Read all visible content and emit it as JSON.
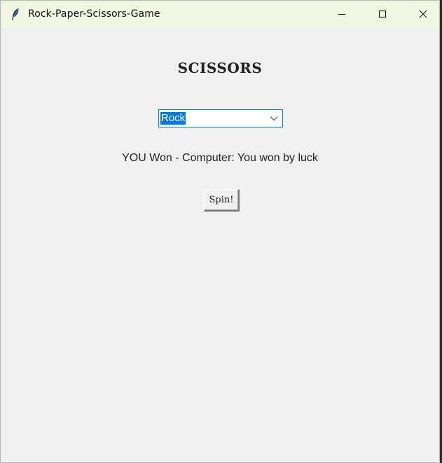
{
  "window": {
    "title": "Rock-Paper-Scissors-Game",
    "icon": "feather-icon",
    "controls": [
      "minimize-icon",
      "maximize-icon",
      "close-icon"
    ]
  },
  "main": {
    "heading": "SCISSORS",
    "choice": {
      "selected": "Rock"
    },
    "result": "YOU Won -  Computer: You won by luck",
    "spin_label": "Spin!"
  },
  "colors": {
    "titlebar": "#eef7e1",
    "accent": "#0078d7",
    "background": "#f0f0f0"
  }
}
